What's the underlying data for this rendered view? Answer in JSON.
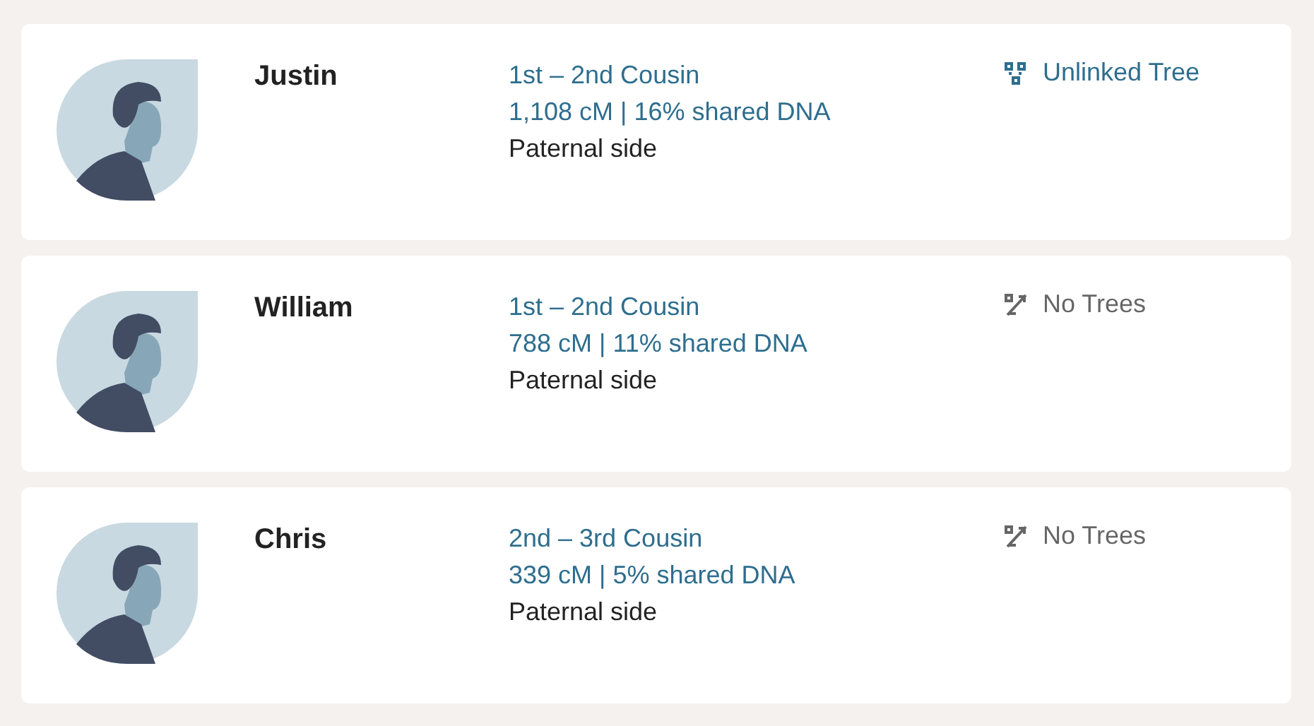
{
  "matches": [
    {
      "name": "Justin",
      "relationship": "1st – 2nd Cousin",
      "shared": "1,108 cM | 16% shared DNA",
      "side": "Paternal side",
      "tree": {
        "kind": "unlinked",
        "label": "Unlinked Tree"
      }
    },
    {
      "name": "William",
      "relationship": "1st – 2nd Cousin",
      "shared": "788 cM | 11% shared DNA",
      "side": "Paternal side",
      "tree": {
        "kind": "none",
        "label": "No Trees"
      }
    },
    {
      "name": "Chris",
      "relationship": "2nd – 3rd Cousin",
      "shared": "339 cM | 5% shared DNA",
      "side": "Paternal side",
      "tree": {
        "kind": "none",
        "label": "No Trees"
      }
    }
  ]
}
